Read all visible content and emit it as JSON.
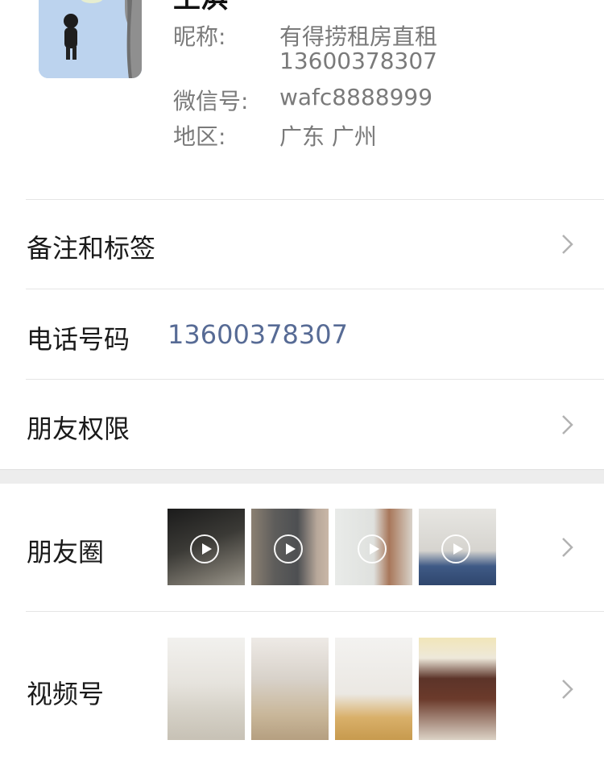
{
  "profile": {
    "name_partial": "王淇",
    "nickname_label": "昵称:",
    "nickname_line1": "有得捞租房直租",
    "nickname_line2": "13600378307",
    "wechat_label": "微信号:",
    "wechat_value": "wafc8888999",
    "region_label": "地区:",
    "region_value": "广东 广州"
  },
  "rows": {
    "remarks_label": "备注和标签",
    "phone_label": "电话号码",
    "phone_value": "13600378307",
    "permissions_label": "朋友权限",
    "moments_label": "朋友圈",
    "channels_label": "视频号"
  },
  "colors": {
    "link": "#576b95",
    "muted_text": "#7a7a7a",
    "divider": "#e5e5e5",
    "section_gap": "#ededed"
  },
  "icons": {
    "chevron": "chevron-right-icon",
    "play": "play-circle-icon"
  }
}
